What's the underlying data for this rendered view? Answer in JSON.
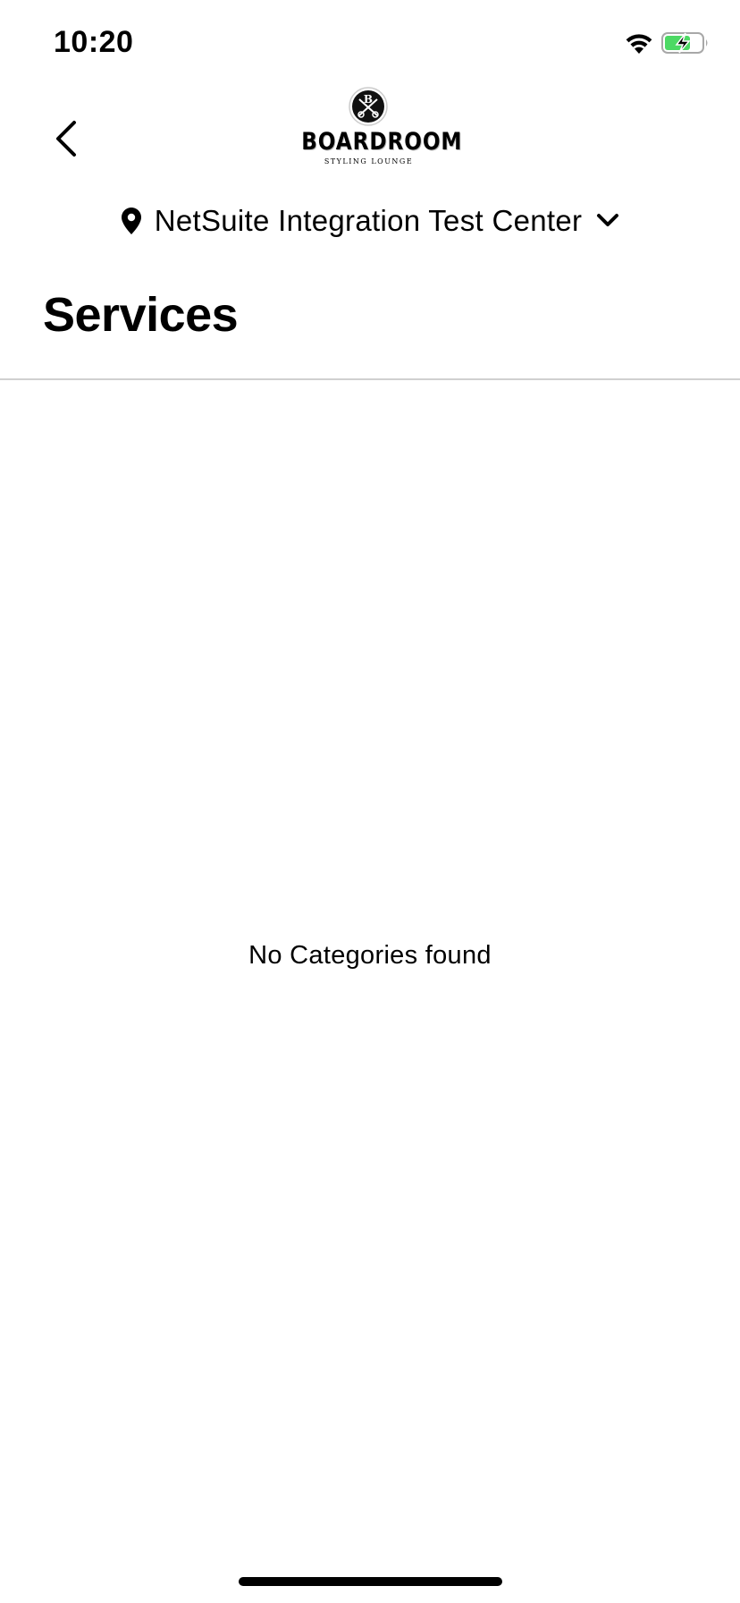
{
  "status_bar": {
    "time": "10:20",
    "wifi_icon": "wifi-icon",
    "battery_icon": "battery-charging-icon",
    "battery_color": "#4cd964"
  },
  "header": {
    "back_icon": "chevron-left-icon",
    "logo": {
      "emblem_letter": "B",
      "name": "BOARDROOM",
      "tagline": "STYLING LOUNGE"
    }
  },
  "location": {
    "icon": "map-pin-icon",
    "name": "NetSuite Integration Test Center",
    "dropdown_icon": "chevron-down-icon"
  },
  "page": {
    "title": "Services",
    "empty_message": "No Categories found"
  },
  "colors": {
    "text": "#000000",
    "background": "#ffffff",
    "divider": "#d0d0d0"
  }
}
